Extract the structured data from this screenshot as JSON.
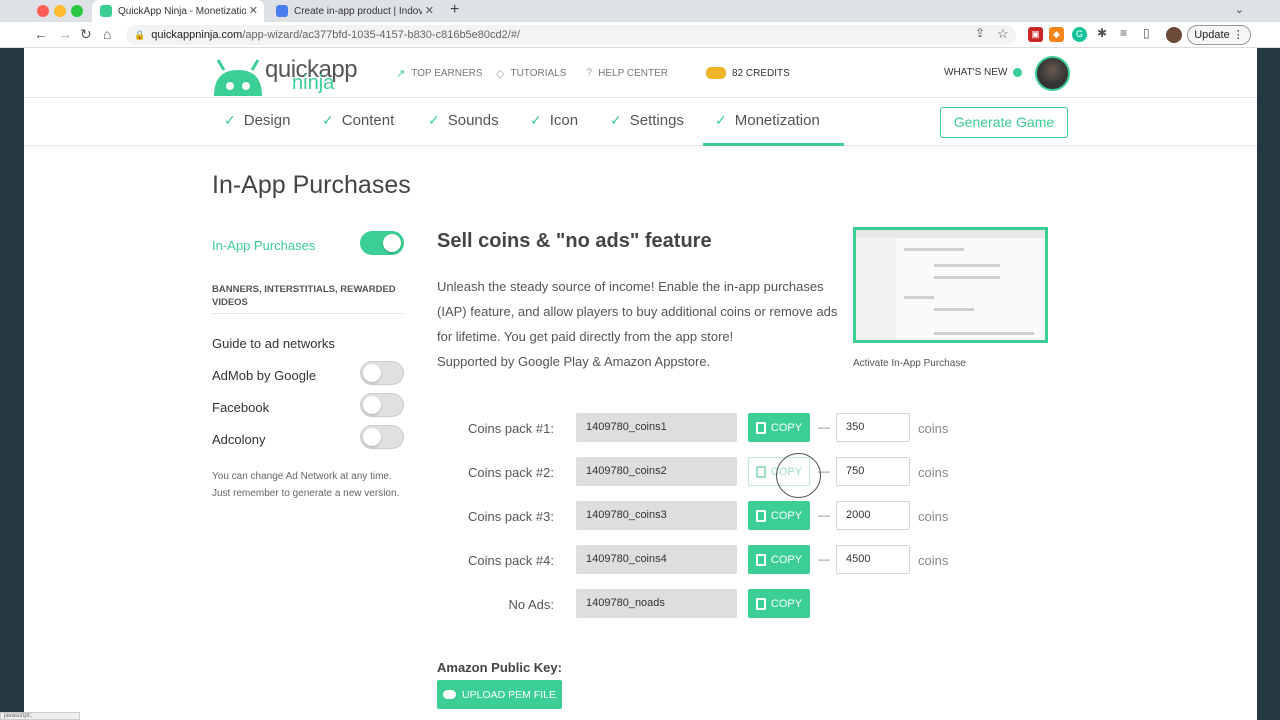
{
  "browser": {
    "tabs": [
      {
        "title": "QuickApp Ninja - Monetization",
        "active": true
      },
      {
        "title": "Create in-app product | Indovi",
        "active": false
      }
    ],
    "url_host": "quickappninja.com",
    "url_path": "/app-wizard/ac377bfd-1035-4157-b830-c816b5e80cd2/#/",
    "update_label": "Update",
    "status_text": "javascript:;"
  },
  "header": {
    "logo_line1": "quickapp",
    "logo_line2": "ninja",
    "nav": [
      {
        "label": "TOP EARNERS",
        "icon": "trend-icon"
      },
      {
        "label": "TUTORIALS",
        "icon": "graduation-cap-icon"
      },
      {
        "label": "HELP CENTER",
        "icon": "help-icon"
      }
    ],
    "credits": "82 CREDITS",
    "whats_new": "WHAT'S NEW"
  },
  "steps": [
    "Design",
    "Content",
    "Sounds",
    "Icon",
    "Settings",
    "Monetization"
  ],
  "active_step": "Monetization",
  "generate_label": "Generate Game",
  "page_title": "In-App Purchases",
  "left": {
    "iap_label": "In-App Purchases",
    "iap_enabled": true,
    "ads_heading": "BANNERS, INTERSTITIALS, REWARDED VIDEOS",
    "guide_label": "Guide to ad networks",
    "networks": [
      {
        "label": "AdMob by Google",
        "enabled": false
      },
      {
        "label": "Facebook",
        "enabled": false
      },
      {
        "label": "Adcolony",
        "enabled": false
      }
    ],
    "note": "You can change Ad Network at any time. Just remember to generate a new version."
  },
  "main": {
    "title": "Sell coins & \"no ads\" feature",
    "description_lines": [
      "Unleash the steady source of income! Enable the in-app purchases",
      "(IAP) feature, and allow players to buy additional coins or remove ads",
      "for lifetime. You get paid directly from the app store!",
      "Supported by Google Play & Amazon Appstore."
    ],
    "thumb_caption": "Activate In-App Purchase",
    "copy_label": "COPY",
    "unit_label": "coins",
    "packs": [
      {
        "label": "Coins pack #1:",
        "id": "1409780_coins1",
        "qty": "350"
      },
      {
        "label": "Coins pack #2:",
        "id": "1409780_coins2",
        "qty": "750"
      },
      {
        "label": "Coins pack #3:",
        "id": "1409780_coins3",
        "qty": "2000"
      },
      {
        "label": "Coins pack #4:",
        "id": "1409780_coins4",
        "qty": "4500"
      }
    ],
    "noads": {
      "label": "No Ads:",
      "id": "1409780_noads"
    },
    "amazon_label": "Amazon Public Key:",
    "upload_label": "UPLOAD PEM FILE"
  },
  "colors": {
    "accent": "#3ccf95",
    "text": "#444444",
    "field_bg": "#dedede"
  }
}
